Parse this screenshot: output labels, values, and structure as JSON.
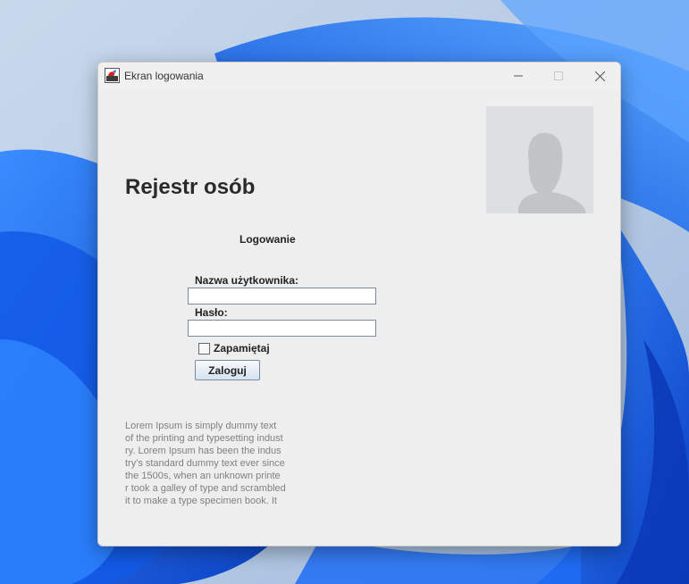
{
  "window": {
    "title": "Ekran logowania",
    "controls": {
      "minimize": "minimize-icon",
      "maximize": "maximize-icon",
      "close": "close-icon"
    }
  },
  "main": {
    "heading": "Rejestr osób",
    "avatar_icon": "person-silhouette-icon"
  },
  "login": {
    "title": "Logowanie",
    "username_label": "Nazwa użytkownika:",
    "username_value": "",
    "password_label": "Hasło:",
    "password_value": "",
    "remember_label": "Zapamiętaj",
    "remember_checked": false,
    "submit_label": "Zaloguj"
  },
  "lorem_lines": [
    "Lorem Ipsum is simply dummy text",
    "of the printing and typesetting indust",
    "ry. Lorem Ipsum has been the indus",
    "try's standard dummy text ever since",
    " the 1500s, when an unknown printe",
    "r took a galley of type and scrambled",
    " it to make a type specimen book. It"
  ],
  "colors": {
    "window_bg": "#eeeeee",
    "desktop_accent": "#1d6ff0",
    "lorem_text": "#808080"
  }
}
